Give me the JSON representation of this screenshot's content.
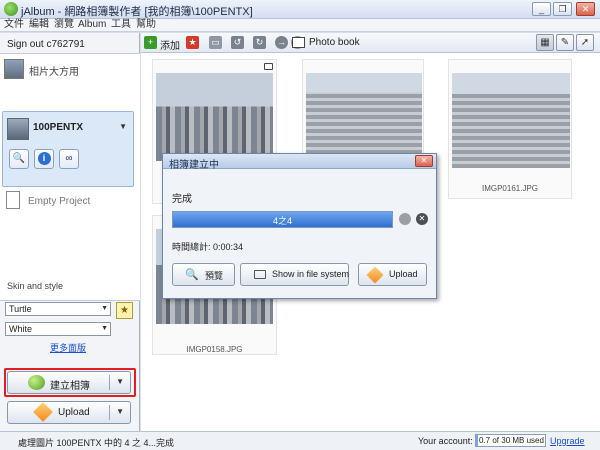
{
  "window": {
    "title": "jAlbum - 網路相簿製作者 [我的相簿\\100PENTX]",
    "icon": "jalbum-app-icon"
  },
  "menu": [
    "文件",
    "編輯",
    "瀏覽",
    "Album",
    "工具",
    "幫助"
  ],
  "left_panel": {
    "sign_out": "Sign out c762791",
    "projects": [
      {
        "label": "相片大方用",
        "icon": "album-thumbnail-icon"
      },
      {
        "label": "100PENTX",
        "selected": true
      },
      {
        "label": "Empty Project",
        "icon": "document-icon"
      }
    ],
    "skin_label": "Skin and style",
    "skin_value": "Turtle",
    "style_value": "White",
    "more_skins_link": "更多面版",
    "make_album_button": "建立相簿",
    "upload_button": "Upload"
  },
  "toolbar": {
    "add_label": "添加",
    "photo_book_label": "Photo book"
  },
  "thumbnails": [
    {
      "caption": ""
    },
    {
      "caption": ""
    },
    {
      "caption": "IMGP0161.JPG"
    },
    {
      "caption": "IMGP0158.JPG"
    }
  ],
  "dialog": {
    "title": "相簿建立中",
    "status": "完成",
    "progress_text": "4之4",
    "progress_fraction": 1.0,
    "time_elapsed": "時間總計: 0:00:34",
    "preview_button": "預覽",
    "show_in_fs_button": "Show in file system",
    "upload_button": "Upload"
  },
  "statusbar": {
    "message": "處理圖片 100PENTX 中的 4 之 4...完成",
    "account_label": "Your account:",
    "account_usage": "0.7 of 30 MB used",
    "usage_fraction": 0.023,
    "upgrade_link": "Upgrade"
  },
  "colors": {
    "accent": "#2f6fd0",
    "highlight": "#e02020",
    "link": "#1a4ed1"
  }
}
